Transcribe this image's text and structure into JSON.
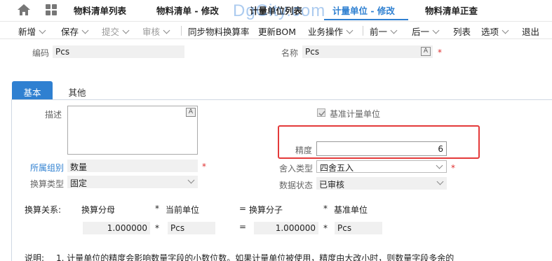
{
  "top_tabs": [
    {
      "label": "物料清单列表"
    },
    {
      "label": "物料清单 - 修改"
    },
    {
      "label": "计量单位列表"
    },
    {
      "label": "计量单位 - 修改"
    },
    {
      "label": "物料清单正查"
    }
  ],
  "watermark": "DgCity.com",
  "toolbar": {
    "new": "新增",
    "save": "保存",
    "submit": "提交",
    "audit": "审核",
    "sync": "同步物料换算率",
    "update_bom": "更新BOM",
    "business_ops": "业务操作",
    "prev": "前一",
    "next": "后一",
    "list": "列表",
    "options": "选项",
    "exit": "退出"
  },
  "header": {
    "code_label": "编码",
    "code_value": "Pcs",
    "name_label": "名称",
    "name_value": "Pcs",
    "lang_icon": "A"
  },
  "subtabs": [
    {
      "label": "基本"
    },
    {
      "label": "其他"
    }
  ],
  "basic": {
    "desc_label": "描述",
    "base_unit_label": "基准计量单位",
    "precision_label": "精度",
    "precision_value": "6",
    "group_label": "所属组别",
    "group_value": "数量",
    "rounding_label": "舍入类型",
    "rounding_value": "四舍五入",
    "conv_type_label": "换算类型",
    "conv_type_value": "固定",
    "status_label": "数据状态",
    "status_value": "已审核"
  },
  "conversion": {
    "rel_label": "换算关系:",
    "denominator_label": "换算分母",
    "star1": "*",
    "current_unit_label": "当前单位",
    "equals": "=",
    "numerator_label": "换算分子",
    "star2": "*",
    "base_unit_label": "基准单位",
    "denominator_value": "1.000000",
    "current_unit_value": "Pcs",
    "numerator_value": "1.000000",
    "base_unit_value": "Pcs"
  },
  "note": {
    "label": "说明:",
    "text": "1. 计量单位的精度会影响数量字段的小数位数。如果计量单位被使用，精度由大改小时，则数量字段多余的"
  },
  "colors": {
    "accent": "#2f80d1",
    "highlight_border": "#e43a3a",
    "required": "#e03030"
  }
}
